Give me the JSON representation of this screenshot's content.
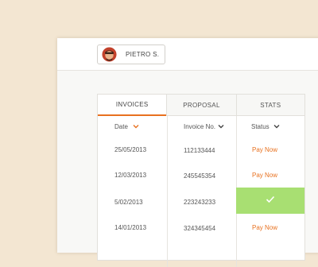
{
  "user": {
    "name": "PIETRO S.",
    "avatar_bg": "#c2412b"
  },
  "tabs": [
    {
      "label": "INVOICES",
      "active": true
    },
    {
      "label": "PROPOSAL",
      "active": false
    },
    {
      "label": "STATS",
      "active": false
    }
  ],
  "columns": [
    {
      "label": "Date",
      "icon": "chevron-down-icon",
      "accent": true
    },
    {
      "label": "Invoice No.",
      "icon": "chevron-down-icon",
      "accent": false
    },
    {
      "label": "Status",
      "icon": "chevron-down-icon",
      "accent": false
    }
  ],
  "rows": [
    {
      "date": "25/05/2013",
      "invoice": "112133444",
      "status": "Pay Now",
      "paid": false
    },
    {
      "date": "12/03/2013",
      "invoice": "245545354",
      "status": "Pay Now",
      "paid": false
    },
    {
      "date": "5/02/2013",
      "invoice": "223243233",
      "status": "",
      "paid": true
    },
    {
      "date": "14/01/2013",
      "invoice": "324345454",
      "status": "Pay Now",
      "paid": false
    }
  ],
  "colors": {
    "accent": "#e8711f",
    "paid": "#a8df72",
    "background": "#f3e6d2"
  }
}
